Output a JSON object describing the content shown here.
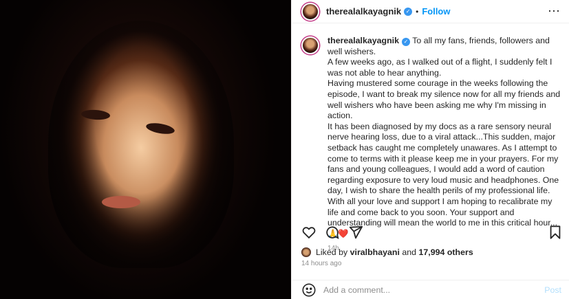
{
  "post": {
    "username": "therealalkayagnik",
    "verified_icon": "verified-badge-icon",
    "follow_label": "Follow",
    "caption_lines": [
      "To all my fans, friends, followers and well wishers.",
      "A few weeks ago, as I walked out of a flight, I suddenly felt I was not able to hear anything.",
      "Having mustered some courage in the weeks following the episode, I want to break my silence now for all my friends and well wishers who have been asking me why I'm missing in action.",
      "It has been diagnosed by my docs as a rare sensory neural nerve hearing loss, due to a viral attack...This sudden, major setback has caught me completely unawares. As I attempt to come to terms with it please keep me in your prayers. For my fans and young colleagues, I would add a word of caution regarding exposure to very loud music and headphones. One day, I wish to share the health perils of my professional life. With all your love and support I am hoping to recalibrate my life and come back to you soon. Your support and understanding will mean the world to me in this critical hour...🙏❤️"
    ],
    "caption_time": "14h",
    "liked_prefix": "Liked by",
    "liked_user": "viralbhayani",
    "liked_and": "and",
    "liked_count": "17,994 others",
    "posted_ago": "14 hours ago",
    "comment_placeholder": "Add a comment...",
    "post_label": "Post",
    "accent_color": "#0095f6"
  }
}
